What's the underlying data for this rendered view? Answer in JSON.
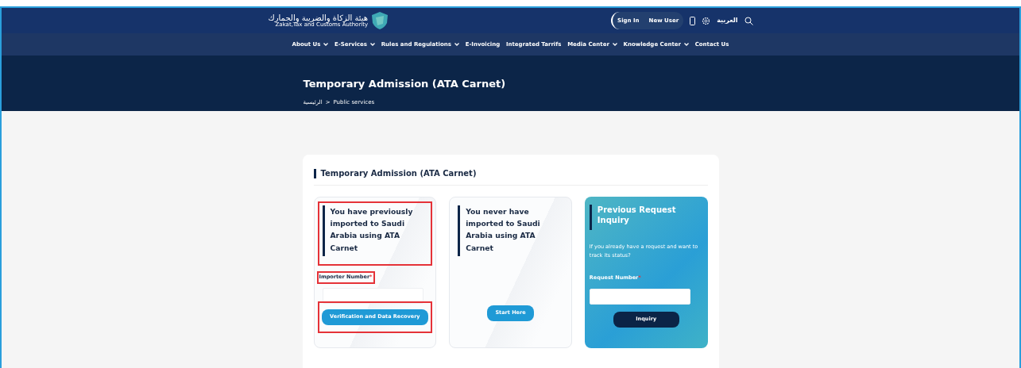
{
  "header": {
    "logo_arabic": "هيئة الزكاة والضريبة والجمارك",
    "logo_english": "Zakat,Tax and Customs Authority",
    "sign_in": "Sign In",
    "new_user": "New User",
    "language": "العربية"
  },
  "nav": [
    {
      "label": "About Us",
      "dropdown": true
    },
    {
      "label": "E-Services",
      "dropdown": true
    },
    {
      "label": "Rules and Regulations",
      "dropdown": true
    },
    {
      "label": "E-Invoicing",
      "dropdown": false
    },
    {
      "label": "Integrated Tarrifs",
      "dropdown": false
    },
    {
      "label": "Media Center",
      "dropdown": true
    },
    {
      "label": "Knowledge Center",
      "dropdown": true
    },
    {
      "label": "Contact Us",
      "dropdown": false
    }
  ],
  "hero": {
    "title": "Temporary Admission (ATA Carnet)",
    "breadcrumb": [
      "الرئيسية",
      "Public services"
    ],
    "separator": ">"
  },
  "section_title": "Temporary Admission (ATA Carnet)",
  "cards": [
    {
      "kind": "option",
      "heading": "You have previously imported to Saudi Arabia using ATA Carnet",
      "highlighted": true,
      "field": {
        "label": "Importer Number",
        "required_mark": "*",
        "highlighted": true
      },
      "button": {
        "label": "Verification and Data Recovery",
        "highlighted": true
      }
    },
    {
      "kind": "option",
      "heading": "You never have imported to Saudi Arabia using ATA Carnet",
      "highlighted": false,
      "button": {
        "label": "Start Here",
        "highlighted": false
      }
    },
    {
      "kind": "inquiry",
      "heading": "Previous Request Inquiry",
      "text": "If you already have a request and want to track its status?",
      "field": {
        "label": "Request Number",
        "required_mark": "*"
      },
      "button": {
        "label": "Inquiry"
      }
    }
  ]
}
